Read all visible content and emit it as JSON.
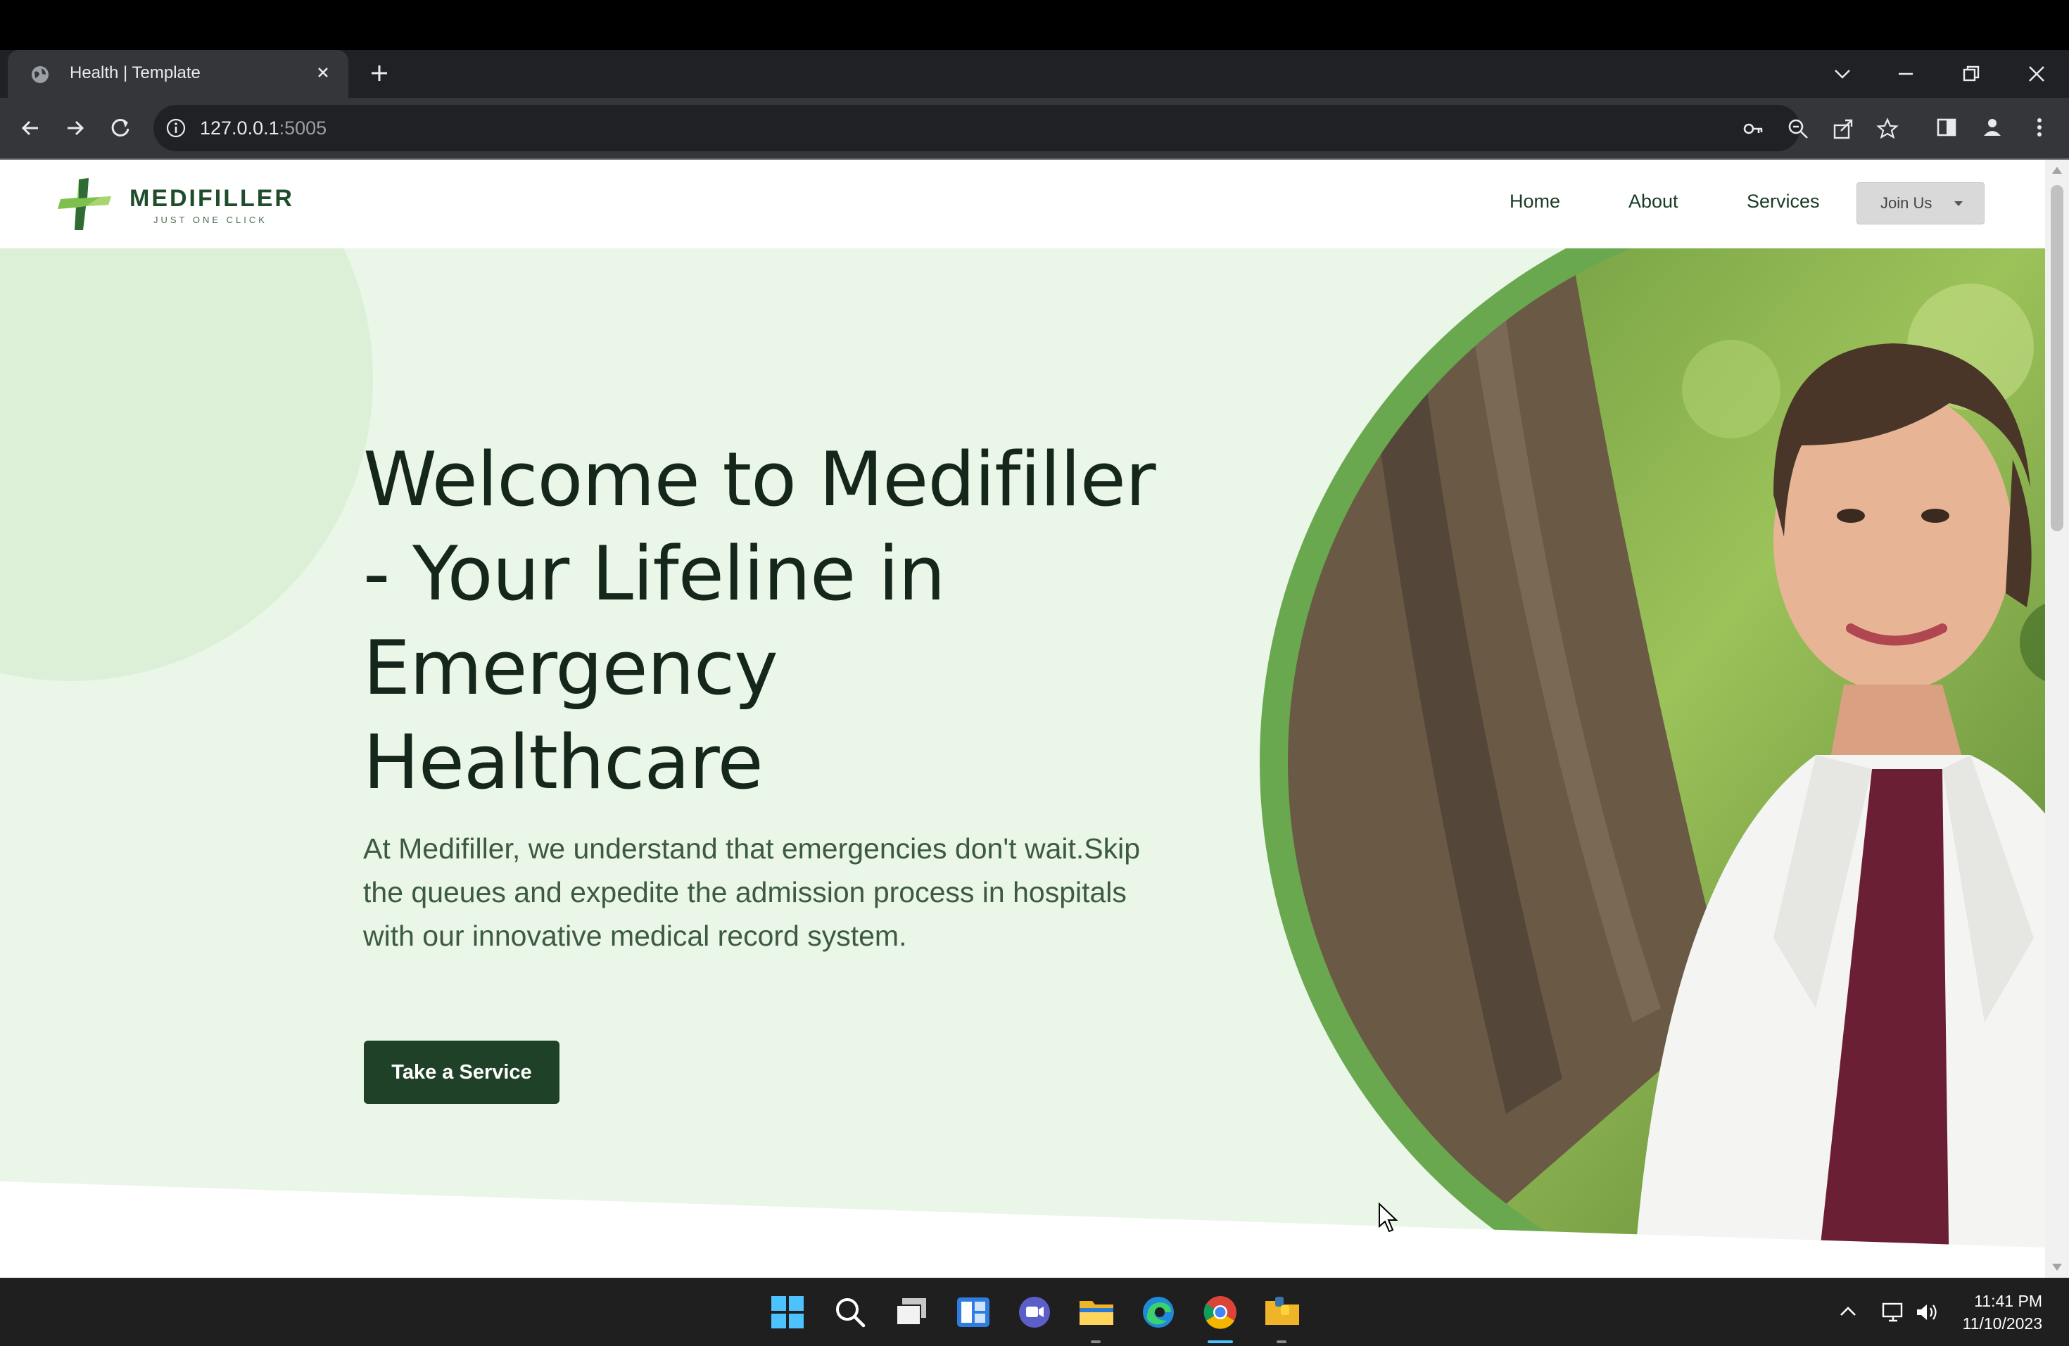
{
  "browser": {
    "tab_title": "Health | Template",
    "url_host": "127.0.0.1",
    "url_port": ":5005"
  },
  "site": {
    "logo_name": "MEDIFILLER",
    "logo_tagline": "JUST ONE CLICK",
    "nav": {
      "home": "Home",
      "about": "About",
      "services": "Services",
      "join": "Join Us"
    }
  },
  "hero": {
    "title": "Welcome to Medifiller - Your Lifeline in Emergency Healthcare",
    "text": "At Medifiller, we understand that emergencies don't wait.Skip the queues and expedite the admission process in hospitals with our innovative medical record system.",
    "cta": "Take a Service"
  },
  "taskbar": {
    "time": "11:41 PM",
    "date": "11/10/2023"
  },
  "colors": {
    "hero_background": "#eaf6e8",
    "accent_green": "#6aa84f",
    "button_dark_green": "#1f4127",
    "title_text": "#15261a"
  }
}
